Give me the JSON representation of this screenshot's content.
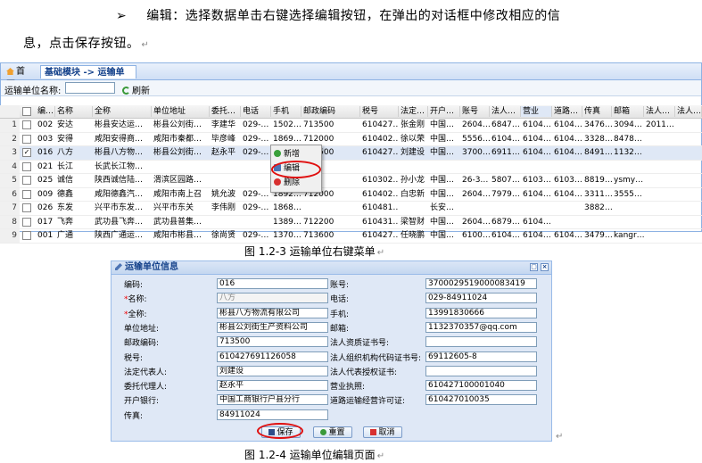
{
  "intro": {
    "bullet": "➢",
    "line1": "编辑：选择数据单击右键选择编辑按钮，在弹出的对话框中修改相应的信",
    "line2": "息，点击保存按钮。",
    "para_mark": "↵"
  },
  "fig1": {
    "tabs": [
      {
        "label": "首页",
        "icon": "home-icon"
      },
      {
        "label": "基础模块 -> 运输单位",
        "close": "×"
      }
    ],
    "search_label": "运输单位名称:",
    "search_value": "",
    "refresh_label": "刷新",
    "columns": [
      "编…",
      "名称",
      "全称",
      "单位地址",
      "委托…",
      "电话",
      "手机",
      "邮政编码",
      "税号",
      "法定…",
      "开户…",
      "账号",
      "法人…",
      "营业",
      "道路…",
      "传真",
      "邮箱",
      "法人…",
      "法人…"
    ],
    "rows": [
      {
        "n": "1",
        "checked": false,
        "c": [
          "002",
          "安达",
          "彬县安达运…",
          "彬县公刘街…",
          "李建华",
          "029-…",
          "1502…",
          "713500",
          "610427…",
          "张金刚",
          "中国…",
          "2604…",
          "6847…",
          "6104…",
          "6104…",
          "3476…",
          "3094…",
          "2011…",
          ""
        ]
      },
      {
        "n": "2",
        "checked": false,
        "c": [
          "003",
          "安得",
          "咸阳安得商…",
          "咸阳市秦都…",
          "毕彦峰",
          "029-…",
          "1869…",
          "712000",
          "610402…",
          "徐以荣",
          "中国…",
          "5556…",
          "6104…",
          "6104…",
          "6104…",
          "3328…",
          "8478…",
          "",
          ""
        ]
      },
      {
        "n": "3",
        "checked": true,
        "c": [
          "016",
          "八方",
          "彬县八方物…",
          "彬县公刘街…",
          "赵永平",
          "029-…",
          "1399…",
          "713500",
          "610427…",
          "刘建设",
          "中国…",
          "3700…",
          "6911…",
          "6104…",
          "6104…",
          "8491…",
          "1132…",
          "",
          ""
        ]
      },
      {
        "n": "4",
        "checked": false,
        "c": [
          "021",
          "长江",
          "长武长江物…",
          "",
          "",
          "",
          "",
          "",
          "",
          "",
          "",
          "",
          "",
          "",
          "",
          "",
          "",
          "",
          ""
        ]
      },
      {
        "n": "5",
        "checked": false,
        "c": [
          "025",
          "诚信",
          "陕西诚信陆…",
          "渭滨区园路…",
          "",
          "",
          "",
          "",
          "610302…",
          "孙小龙",
          "中国…",
          "26-3…",
          "5807…",
          "6103…",
          "6103…",
          "8819…",
          "ysmy…",
          "",
          ""
        ]
      },
      {
        "n": "6",
        "checked": false,
        "c": [
          "009",
          "德鑫",
          "咸阳德鑫汽…",
          "咸阳市南上召",
          "姚允波",
          "029-…",
          "1892…",
          "712000",
          "610402…",
          "白忠新",
          "中国…",
          "2604…",
          "7979…",
          "6104…",
          "6104…",
          "3311…",
          "3555…",
          "",
          ""
        ]
      },
      {
        "n": "7",
        "checked": false,
        "c": [
          "026",
          "东发",
          "兴平市东发…",
          "兴平市东关",
          "李伟刚",
          "029-…",
          "1868…",
          "",
          "610481…",
          "",
          "长安…",
          "",
          "",
          "",
          "",
          "3882…",
          "",
          "",
          ""
        ]
      },
      {
        "n": "8",
        "checked": false,
        "c": [
          "017",
          "飞奔",
          "武功县飞奔…",
          "武功县普集…",
          "",
          "",
          "1389…",
          "712200",
          "610431…",
          "梁智财",
          "中国…",
          "2604…",
          "6879…",
          "6104…",
          "",
          "",
          "",
          "",
          ""
        ]
      },
      {
        "n": "9",
        "checked": false,
        "c": [
          "001",
          "广通",
          "陕西广通运…",
          "咸阳市彬县…",
          "徐尚贤",
          "029-…",
          "1370…",
          "713600",
          "610427…",
          "任晓鹏",
          "中国…",
          "6100…",
          "6104…",
          "6104…",
          "6104…",
          "3479…",
          "kangr…",
          "",
          ""
        ]
      }
    ],
    "context_menu": [
      {
        "label": "新增",
        "icon": "plus-icon",
        "color": "#3aa03a"
      },
      {
        "label": "编辑",
        "icon": "edit-icon",
        "color": "#4d74b5"
      },
      {
        "label": "删除",
        "icon": "minus-icon",
        "color": "#d83030"
      }
    ],
    "caption": "图 1.2-3  运输单位右键菜单"
  },
  "fig2": {
    "title": "运输单位信息",
    "fields_left": [
      {
        "label": "编码:",
        "value": "016",
        "required": false,
        "disabled": false
      },
      {
        "label": "名称:",
        "value": "八方",
        "required": true,
        "disabled": true
      },
      {
        "label": "全称:",
        "value": "彬县八方物流有限公司",
        "required": true,
        "disabled": false
      },
      {
        "label": "单位地址:",
        "value": "彬县公刘街生产资料公司",
        "required": false,
        "disabled": false
      },
      {
        "label": "邮政编码:",
        "value": "713500",
        "required": false,
        "disabled": false
      },
      {
        "label": "税号:",
        "value": "610427691126058",
        "required": false,
        "disabled": false
      },
      {
        "label": "法定代表人:",
        "value": "刘建设",
        "required": false,
        "disabled": false
      },
      {
        "label": "委托代理人:",
        "value": "赵永平",
        "required": false,
        "disabled": false
      },
      {
        "label": "开户银行:",
        "value": "中国工商银行户县分行",
        "required": false,
        "disabled": false
      },
      {
        "label": "传真:",
        "value": "84911024",
        "required": false,
        "disabled": false
      }
    ],
    "fields_right": [
      {
        "label": "账号:",
        "value": "3700029519000083419"
      },
      {
        "label": "电话:",
        "value": "029-84911024"
      },
      {
        "label": "手机:",
        "value": "13991830666"
      },
      {
        "label": "邮箱:",
        "value": "1132370357@qq.com"
      },
      {
        "label": "法人资质证书号:",
        "value": ""
      },
      {
        "label": "法人组织机构代码证书号:",
        "value": "69112605-8"
      },
      {
        "label": "法人代表授权证书:",
        "value": ""
      },
      {
        "label": "营业执照:",
        "value": "610427100001040"
      },
      {
        "label": "道路运输经营许可证:",
        "value": "610427010035"
      }
    ],
    "buttons": [
      {
        "label": "保存",
        "icon": "save-icon",
        "color": "#2d4d8a"
      },
      {
        "label": "重置",
        "icon": "reset-icon",
        "color": "#3a9a3a"
      },
      {
        "label": "取消",
        "icon": "cancel-icon",
        "color": "#d83030"
      }
    ],
    "caption": "图 1.2-4  运输单位编辑页面"
  }
}
